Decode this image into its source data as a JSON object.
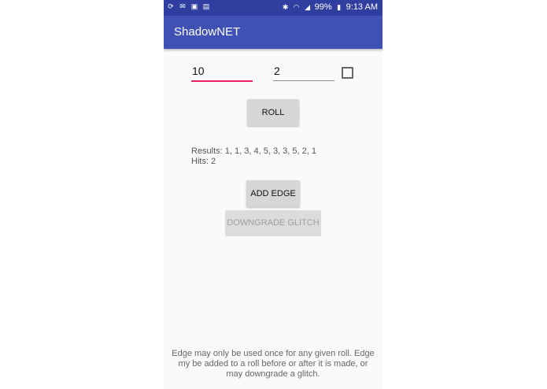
{
  "status_bar": {
    "battery": "99%",
    "time": "9:13 AM",
    "icons": [
      "sync-icon",
      "mail-icon",
      "image-icon",
      "photo-icon",
      "bluetooth-icon",
      "wifi-icon",
      "signal-icon",
      "battery-icon"
    ]
  },
  "app_bar": {
    "title": "ShadowNET"
  },
  "inputs": {
    "dice_count": "10",
    "threshold": "2",
    "checkbox_checked": false
  },
  "buttons": {
    "roll": "ROLL",
    "add_edge": "ADD EDGE",
    "downgrade_glitch": "DOWNGRADE GLITCH"
  },
  "results": {
    "line1": "Results: 1, 1, 3, 4, 5, 3, 3, 5, 2, 1",
    "line2": "Hits: 2"
  },
  "footer": {
    "note": "Edge may only be used once for any given roll. Edge my be added to a roll before or after it is made, or may downgrade a glitch."
  },
  "colors": {
    "status_bar": "#303f9f",
    "app_bar": "#3f51b5",
    "accent": "#e91e63"
  }
}
